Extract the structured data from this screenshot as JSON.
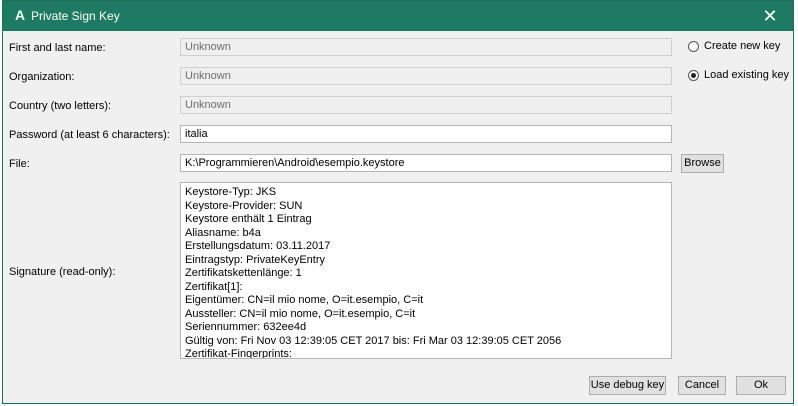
{
  "window": {
    "title": "Private Sign Key",
    "app_icon_glyph": "A",
    "close_glyph": "✕",
    "titlebar_color": "#1e7a63"
  },
  "form": {
    "name_label": "First and last name:",
    "name_value": "Unknown",
    "org_label": "Organization:",
    "org_value": "Unknown",
    "country_label": "Country (two letters):",
    "country_value": "Unknown",
    "password_label": "Password (at least 6 characters):",
    "password_value": "italia",
    "file_label": "File:",
    "file_value": "K:\\Programmieren\\Android\\esempio.keystore",
    "browse_label": "Browse",
    "signature_label": "Signature (read-only):"
  },
  "options": {
    "create_label": "Create new key",
    "create_checked": false,
    "load_label": "Load existing key",
    "load_checked": true
  },
  "signature": {
    "lines": [
      "Keystore-Typ: JKS",
      "Keystore-Provider: SUN",
      "Keystore enthält 1 Eintrag",
      "Aliasname: b4a",
      "Erstellungsdatum: 03.11.2017",
      "Eintragstyp: PrivateKeyEntry",
      "Zertifikatskettenlänge: 1",
      "Zertifikat[1]:",
      "Eigentümer: CN=il mio nome, O=it.esempio, C=it",
      "Aussteller: CN=il mio nome, O=it.esempio, C=it",
      "Seriennummer: 632ee4d",
      "Gültig von: Fri Nov 03 12:39:05 CET 2017 bis: Fri Mar 03 12:39:05 CET 2056",
      "Zertifikat-Fingerprints:"
    ]
  },
  "buttons": {
    "debug_label": "Use debug key",
    "cancel_label": "Cancel",
    "ok_label": "Ok"
  }
}
